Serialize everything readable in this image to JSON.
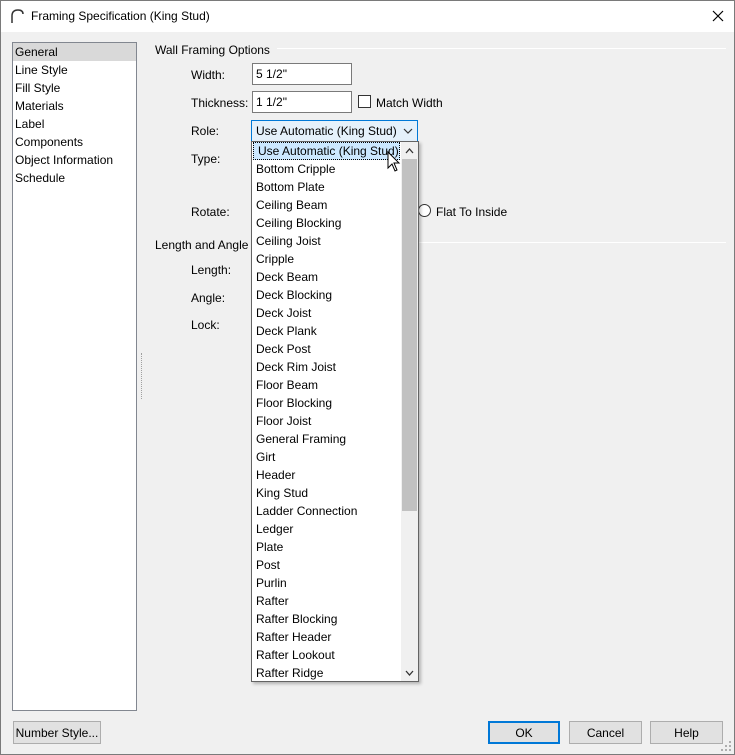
{
  "window": {
    "title": "Framing Specification (King Stud)"
  },
  "nav": {
    "items": [
      {
        "label": "General",
        "selected": true
      },
      {
        "label": "Line Style",
        "selected": false
      },
      {
        "label": "Fill Style",
        "selected": false
      },
      {
        "label": "Materials",
        "selected": false
      },
      {
        "label": "Label",
        "selected": false
      },
      {
        "label": "Components",
        "selected": false
      },
      {
        "label": "Object Information",
        "selected": false
      },
      {
        "label": "Schedule",
        "selected": false
      }
    ]
  },
  "wall_framing": {
    "group_label": "Wall Framing Options",
    "width_label": "Width:",
    "width_value": "5 1/2\"",
    "thickness_label": "Thickness:",
    "thickness_value": "1 1/2\"",
    "match_width_label": "Match Width",
    "role_label": "Role:",
    "role_value": "Use Automatic (King Stud)",
    "type_label": "Type:",
    "rotate_label": "Rotate:",
    "flat_to_inside_label": "Flat To Inside"
  },
  "length_angle": {
    "group_label": "Length and Angle",
    "length_label": "Length:",
    "angle_label": "Angle:",
    "lock_label": "Lock:"
  },
  "role_dropdown": {
    "options": [
      "Use Automatic (King Stud)",
      "Bottom Cripple",
      "Bottom Plate",
      "Ceiling Beam",
      "Ceiling Blocking",
      "Ceiling Joist",
      "Cripple",
      "Deck Beam",
      "Deck Blocking",
      "Deck Joist",
      "Deck Plank",
      "Deck Post",
      "Deck Rim Joist",
      "Floor Beam",
      "Floor Blocking",
      "Floor Joist",
      "General Framing",
      "Girt",
      "Header",
      "King Stud",
      "Ladder Connection",
      "Ledger",
      "Plate",
      "Post",
      "Purlin",
      "Rafter",
      "Rafter Blocking",
      "Rafter Header",
      "Rafter Lookout",
      "Rafter Ridge"
    ],
    "highlighted_index": 0
  },
  "buttons": {
    "number_style": "Number Style...",
    "ok": "OK",
    "cancel": "Cancel",
    "help": "Help"
  },
  "colors": {
    "accent": "#0078d7",
    "highlight": "#cce8ff"
  }
}
